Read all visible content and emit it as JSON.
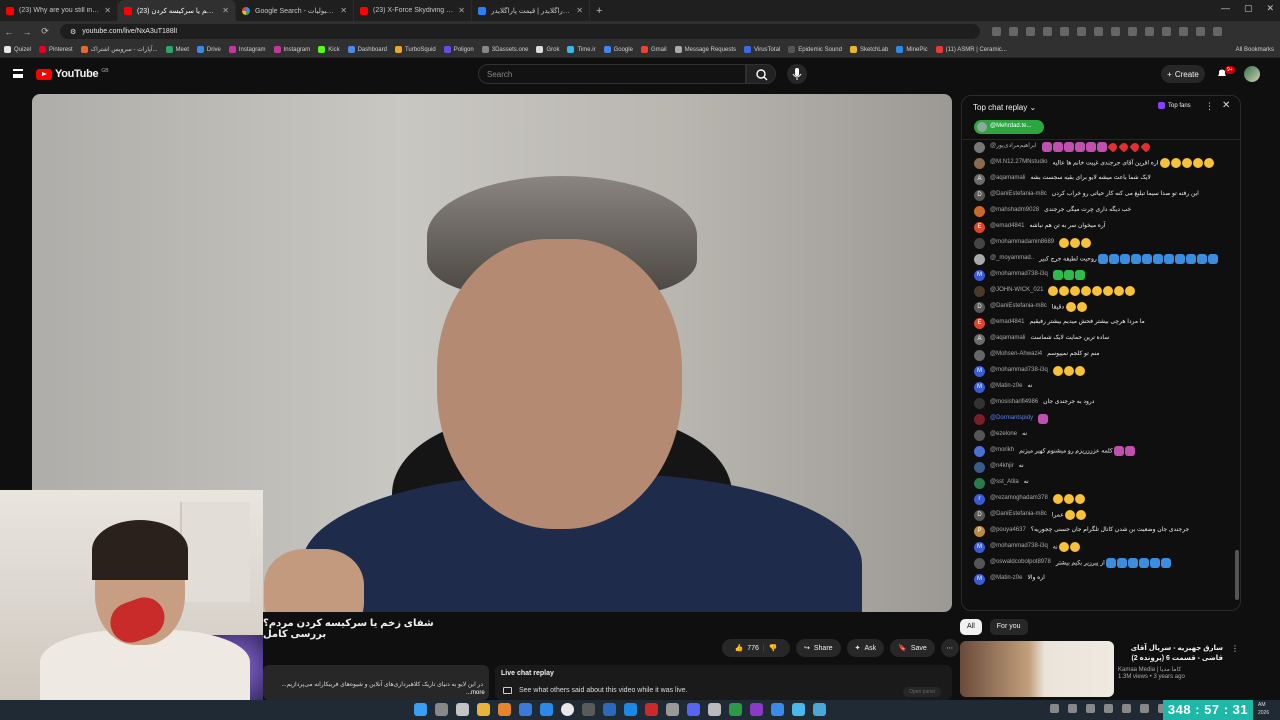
{
  "browser": {
    "tabs": [
      {
        "title": "(23) Why are you still in touch...",
        "active": false,
        "favicon": "youtube-icon"
      },
      {
        "title": "(23) شفای زخم یا سرکیسه کردن...",
        "active": true,
        "favicon": "youtube-icon"
      },
      {
        "title": "Google Search - میزان قبولیات",
        "active": false,
        "favicon": "google-icon"
      },
      {
        "title": "(23) X-Force Skydiving - Brad P...",
        "active": false,
        "favicon": "youtube-icon"
      },
      {
        "title": "خرید پاراگلایدر | قیمت پاراگلایدر...",
        "active": false,
        "favicon": "site-icon"
      }
    ],
    "new_tab_label": "+",
    "url": "youtube.com/live/NxA3uT188lI",
    "bookmarks": [
      "Quizel",
      "Pinterest",
      "آپارات - سرویس اشتراک...",
      "Meet",
      "Drive",
      "Instagram",
      "Instagram",
      "Kick",
      "Dashboard",
      "TurboSquid",
      "Poligon",
      "3Dassets.one",
      "Grok",
      "Time.ir",
      "Google",
      "Gmail",
      "Message Requests",
      "VirusTotal",
      "Epidemic Sound",
      "SketchLab",
      "MinePic",
      "(11) ASMR | Ceramic..."
    ],
    "all_bookmarks_label": "All Bookmarks"
  },
  "youtube": {
    "logo_text": "YouTube",
    "logo_country": "GB",
    "search_placeholder": "Search",
    "create_label": "Create",
    "notif_badge": "9+"
  },
  "video": {
    "title": "شفای زخم یا سرکیسه کردن مردم؟ بررسی کامل",
    "like_count": "776",
    "share_label": "Share",
    "ask_label": "Ask",
    "save_label": "Save",
    "description": "در این لایو به دنیای تاریک کلاهبرداری‌های آنلاین و شیوه‌های فریبکارانه می‌پردازیم...",
    "more_label": "...more",
    "live_chat_replay_heading": "Live chat replay",
    "live_chat_replay_sub": "See what others said about this video while it was live.",
    "open_panel_label": "Open panel"
  },
  "chat": {
    "header": "Top chat replay",
    "top_fans_label": "Top fans",
    "pinned_user": "@Mehrdad.te...",
    "messages": [
      {
        "author": "@ابراهیم‌مرادی‌پور",
        "text": "",
        "emojis": "pppppprrrr",
        "av": "#777"
      },
      {
        "author": "@M.N12.27MNstudio",
        "text": "اره افرین آقای جرجندی غیبت خانم ها عالیه",
        "emojis": "yy yyy",
        "av": "#8a6a50"
      },
      {
        "author": "@aqamamali",
        "text": "لایک شما باعث میشه لایو برای بقیه سجست بشه",
        "emojis": "",
        "av": "#6b6b6b",
        "letter": "A"
      },
      {
        "author": "@DaniEstefania-m8c",
        "text": "این رفته تو صدا سیما تبلیغ می کنه کار حیاتی رو خراب کردن",
        "emojis": "",
        "av": "#555",
        "letter": "D"
      },
      {
        "author": "@mahshadm9028",
        "text": "خب دیگه داری چرت میگی جرجندی",
        "emojis": "",
        "av": "#c96a2a"
      },
      {
        "author": "@emad4841",
        "text": "آره میخوان سر به تن هم نباشه",
        "emojis": "",
        "av": "#e0432b",
        "letter": "E"
      },
      {
        "author": "@mohammadamin8689",
        "text": "",
        "emojis": "yyy",
        "av": "#444"
      },
      {
        "author": "@_moyammad..",
        "text": "روحیت لطیفه جرج کبیر",
        "emojis": "bbbbbbbbbbb",
        "av": "#aaa"
      },
      {
        "author": "@mohammad738-i3q",
        "text": "",
        "emojis": "ggg",
        "av": "#3b5bd6",
        "letter": "M"
      },
      {
        "author": "@JOHN-WICK_021",
        "text": "",
        "emojis": "yyyyyyyy",
        "av": "#4a3a2a"
      },
      {
        "author": "@DaniEstefania-m8c",
        "text": "دقیقا",
        "emojis": "yy",
        "av": "#555",
        "letter": "D"
      },
      {
        "author": "@emad4841",
        "text": "ما مردا هرچی بیشتر فحش میدیم بیشتر رفیقیم",
        "emojis": "",
        "av": "#e0432b",
        "letter": "E"
      },
      {
        "author": "@aqamamali",
        "text": "ساده ترین حمایت لایک شماست",
        "emojis": "",
        "av": "#6b6b6b",
        "letter": "A"
      },
      {
        "author": "@Mohsen-Ahwazi4",
        "text": "منم تو کلجم نمیپوسم",
        "emojis": "",
        "av": "#666"
      },
      {
        "author": "@mohammad738-i3q",
        "text": "",
        "emojis": "yyy",
        "av": "#3b5bd6",
        "letter": "M"
      },
      {
        "author": "@Matin-z0e",
        "text": "نه",
        "emojis": "",
        "av": "#3b5bd6",
        "letter": "M"
      },
      {
        "author": "@mosisharifi4986",
        "text": "درود به جرجندی جان",
        "emojis": "",
        "av": "#333"
      },
      {
        "author": "@Dormantspidy",
        "text": "",
        "emojis": "p",
        "av": "#7a1f2a",
        "member": true
      },
      {
        "author": "@ezelone",
        "text": "نه",
        "emojis": "",
        "av": "#555"
      },
      {
        "author": "@morikh",
        "text": "کلمه عززززیزم رو میشنوم کهیر میزنم",
        "emojis": "pp",
        "av": "#4a6fd6"
      },
      {
        "author": "@n4khjir",
        "text": "نه",
        "emojis": "",
        "av": "#3a5a8a"
      },
      {
        "author": "@sst_Atila",
        "text": "نه",
        "emojis": "",
        "av": "#2a7a4a"
      },
      {
        "author": "@rezamoghadam378",
        "text": "",
        "emojis": "yyy",
        "av": "#3b5bd6",
        "letter": "r"
      },
      {
        "author": "@DaniEstefania-m8c",
        "text": "عمرا",
        "emojis": "yy",
        "av": "#555",
        "letter": "D"
      },
      {
        "author": "@pouya4637",
        "text": "جرجندی جان وضعیت بن شدن کانال تلگرام جان حسنی چجوریه؟",
        "emojis": "",
        "av": "#c08a3a",
        "letter": "P"
      },
      {
        "author": "@mohammad738-i3q",
        "text": "نه",
        "emojis": "yy",
        "av": "#3b5bd6",
        "letter": "M"
      },
      {
        "author": "@oswaldcobolpot8978",
        "text": "از پیرزیر بکیم بیشتر",
        "emojis": "bbbbbb",
        "av": "#555"
      },
      {
        "author": "@Matin-z0e",
        "text": "اره والا",
        "emojis": "",
        "av": "#3b5bd6",
        "letter": "M"
      }
    ]
  },
  "recommendations": {
    "chips": [
      "All",
      "For you"
    ],
    "items": [
      {
        "title": "سارق جهیزیه - سریال آقای قاضی - قسمت 6 (پرونده 2)",
        "channel": "Kamaa Media | کاما مدیا",
        "views": "1.3M views • 3 years ago"
      }
    ]
  },
  "taskbar": {
    "timer": "348 : 57 : 31",
    "clock_time": "AM",
    "clock_date": "2026"
  },
  "colors": {
    "yt_red": "#ff0000",
    "bg": "#0f0f0f",
    "chip_bg": "#272727",
    "timer_bg": "#1fb8a8",
    "pinned_green": "#2ba640"
  }
}
